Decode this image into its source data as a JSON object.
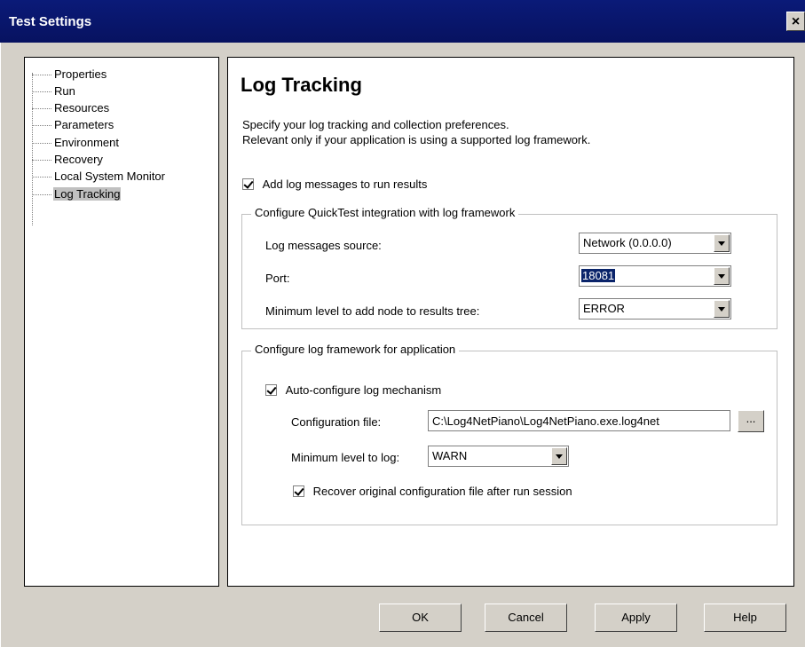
{
  "window": {
    "title": "Test Settings",
    "close_glyph": "×"
  },
  "tree": {
    "items": [
      {
        "label": "Properties"
      },
      {
        "label": "Run"
      },
      {
        "label": "Resources"
      },
      {
        "label": "Parameters"
      },
      {
        "label": "Environment"
      },
      {
        "label": "Recovery"
      },
      {
        "label": "Local System Monitor"
      },
      {
        "label": "Log Tracking",
        "selected": true
      }
    ]
  },
  "page": {
    "heading": "Log Tracking",
    "desc_line1": "Specify your log tracking and collection preferences.",
    "desc_line2": "Relevant only if your application is using a supported log framework.",
    "add_log": {
      "label": "Add log messages to run results",
      "checked": true
    }
  },
  "integration": {
    "legend": "Configure QuickTest integration with log framework",
    "source_label": "Log messages source:",
    "source_value": "Network (0.0.0.0)",
    "port_label": "Port:",
    "port_value": "18081",
    "min_level_label": "Minimum level to add node to results tree:",
    "min_level_value": "ERROR"
  },
  "framework": {
    "legend": "Configure log framework for application",
    "auto_label": "Auto-configure log mechanism",
    "auto_checked": true,
    "config_file_label": "Configuration file:",
    "config_file_value": "C:\\Log4NetPiano\\Log4NetPiano.exe.log4net",
    "browse_label": "...",
    "min_log_label": "Minimum level to log:",
    "min_log_value": "WARN",
    "recover_label": "Recover original configuration file after run session",
    "recover_checked": true
  },
  "buttons": {
    "ok": "OK",
    "cancel": "Cancel",
    "apply": "Apply",
    "help": "Help"
  }
}
